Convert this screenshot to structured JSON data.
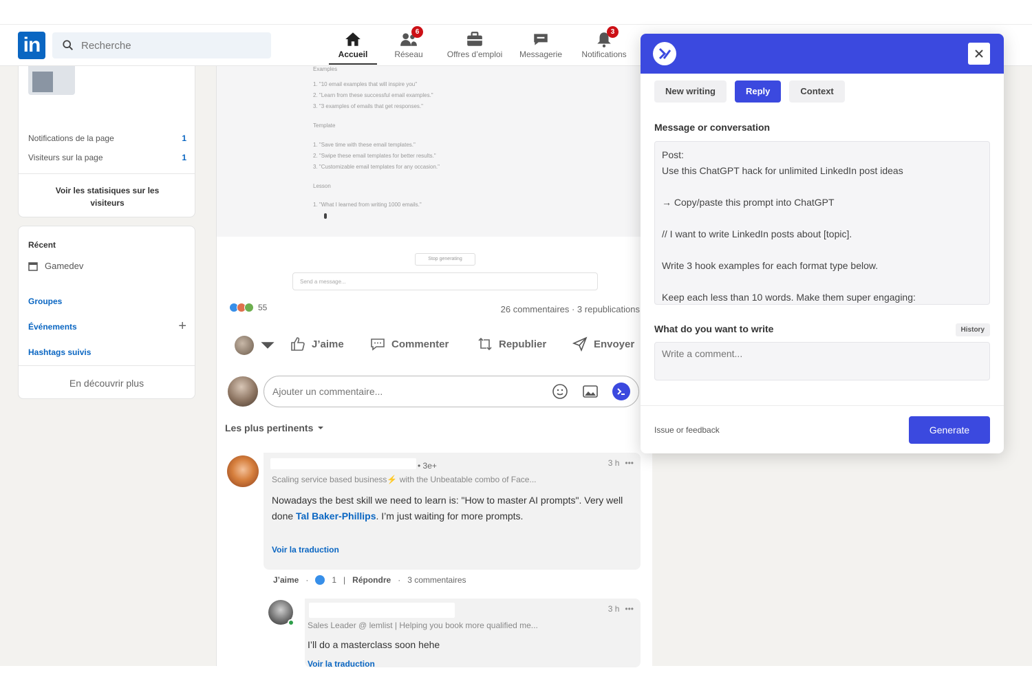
{
  "nav": {
    "search_placeholder": "Recherche",
    "items": [
      {
        "label": "Accueil",
        "icon": "home-icon",
        "active": true
      },
      {
        "label": "Réseau",
        "icon": "network-icon",
        "badge": "6"
      },
      {
        "label": "Offres d’emploi",
        "icon": "briefcase-icon"
      },
      {
        "label": "Messagerie",
        "icon": "message-icon"
      },
      {
        "label": "Notifications",
        "icon": "bell-icon",
        "badge": "3"
      }
    ]
  },
  "left": {
    "stats": [
      {
        "label": "Notifications de la page",
        "value": "1"
      },
      {
        "label": "Visiteurs sur la page",
        "value": "1"
      }
    ],
    "visitors_link": "Voir les statisiques sur les visiteurs",
    "recent_title": "Récent",
    "recent_item": "Gamedev",
    "links": [
      "Groupes",
      "Événements",
      "Hashtags suivis"
    ],
    "discover": "En découvrir plus"
  },
  "post": {
    "screenshot": {
      "section1": "Examples",
      "items1": [
        "1. \"10 email examples that will inspire you\"",
        "2. \"Learn from these successful email examples.\"",
        "3. \"3 examples of emails that get responses.\""
      ],
      "section2": "Template",
      "items2": [
        "1. \"Save time with these email templates.\"",
        "2. \"Swipe these email templates for better results.\"",
        "3. \"Customizable email templates for any occasion.\""
      ],
      "section3": "Lesson",
      "items3": [
        "1. \"What I learned from writing 1000 emails.\""
      ],
      "stop": "Stop generating",
      "send_placeholder": "Send a message..."
    },
    "reaction_count": "55",
    "stats": "26 commentaires · 3 republications",
    "actions": {
      "like": "J’aime",
      "comment": "Commenter",
      "repost": "Republier",
      "send": "Envoyer"
    },
    "add_comment_placeholder": "Ajouter un commentaire...",
    "sort": "Les plus pertinents"
  },
  "comments": [
    {
      "degree": "• 3e+",
      "headline": "Scaling service based business⚡ with the Unbeatable combo of Face...",
      "time": "3 h",
      "text_before": "Nowadays the best skill we need to learn is: \"How to master AI prompts\". Very well done ",
      "tag": "Tal Baker-Phillips",
      "text_after": ". I’m just waiting for more prompts.",
      "translate": "Voir la traduction",
      "like": "J’aime",
      "like_count": "1",
      "reply": "Répondre",
      "replies": "3 commentaires"
    },
    {
      "headline": "Sales Leader @ lemlist | Helping you book more qualified me...",
      "time": "3 h",
      "text": "I’ll do a masterclass soon hehe",
      "translate": "Voir la traduction"
    }
  ],
  "panel": {
    "tabs": [
      "New writing",
      "Reply",
      "Context"
    ],
    "active_tab": "Reply",
    "message_label": "Message or conversation",
    "message_lines": [
      "Post:",
      "Use this ChatGPT hack for unlimited LinkedIn post ideas",
      "",
      "→ Copy/paste this prompt into ChatGPT",
      "",
      "// I want to write LinkedIn posts about [topic].",
      "",
      "Write 3 hook examples for each format type below.",
      "",
      "Keep each less than 10 words. Make them super engaging:"
    ],
    "write_label": "What do you want to write",
    "history": "History",
    "write_placeholder": "Write a comment...",
    "feedback": "Issue or feedback",
    "generate": "Generate"
  },
  "colors": {
    "linkedin_blue": "#0a66c2",
    "panel_accent": "#3b49df",
    "badge_red": "#cc1016"
  }
}
